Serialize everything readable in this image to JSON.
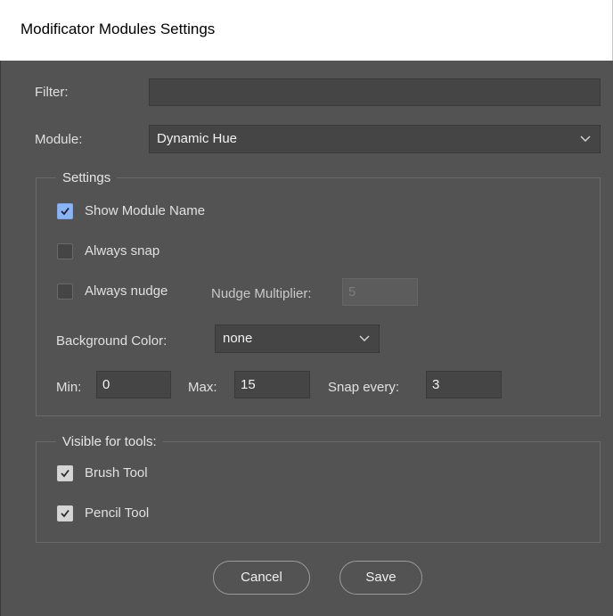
{
  "window": {
    "title": "Modificator Modules Settings"
  },
  "filter": {
    "label": "Filter:",
    "value": ""
  },
  "module": {
    "label": "Module:",
    "selected": "Dynamic Hue"
  },
  "settings": {
    "legend": "Settings",
    "show_module_name": {
      "label": "Show Module Name",
      "checked": true
    },
    "always_snap": {
      "label": "Always snap",
      "checked": false
    },
    "always_nudge": {
      "label": "Always nudge",
      "checked": false
    },
    "nudge_multiplier": {
      "label": "Nudge Multiplier:",
      "value": "5"
    },
    "background_color": {
      "label": "Background Color:",
      "selected": "none"
    },
    "min": {
      "label": "Min:",
      "value": "0"
    },
    "max": {
      "label": "Max:",
      "value": "15"
    },
    "snap_every": {
      "label": "Snap every:",
      "value": "3"
    }
  },
  "visible_tools": {
    "legend": "Visible for tools:",
    "brush_tool": {
      "label": "Brush Tool",
      "checked": true
    },
    "pencil_tool": {
      "label": "Pencil Tool",
      "checked": true
    }
  },
  "buttons": {
    "cancel": "Cancel",
    "save": "Save"
  },
  "colors": {
    "background": "#535353",
    "field": "#454545",
    "accent_checkbox": "#8ab4f8"
  },
  "icons": {
    "checkmark": "checkmark-icon",
    "dropdown": "chevron-down-icon"
  }
}
